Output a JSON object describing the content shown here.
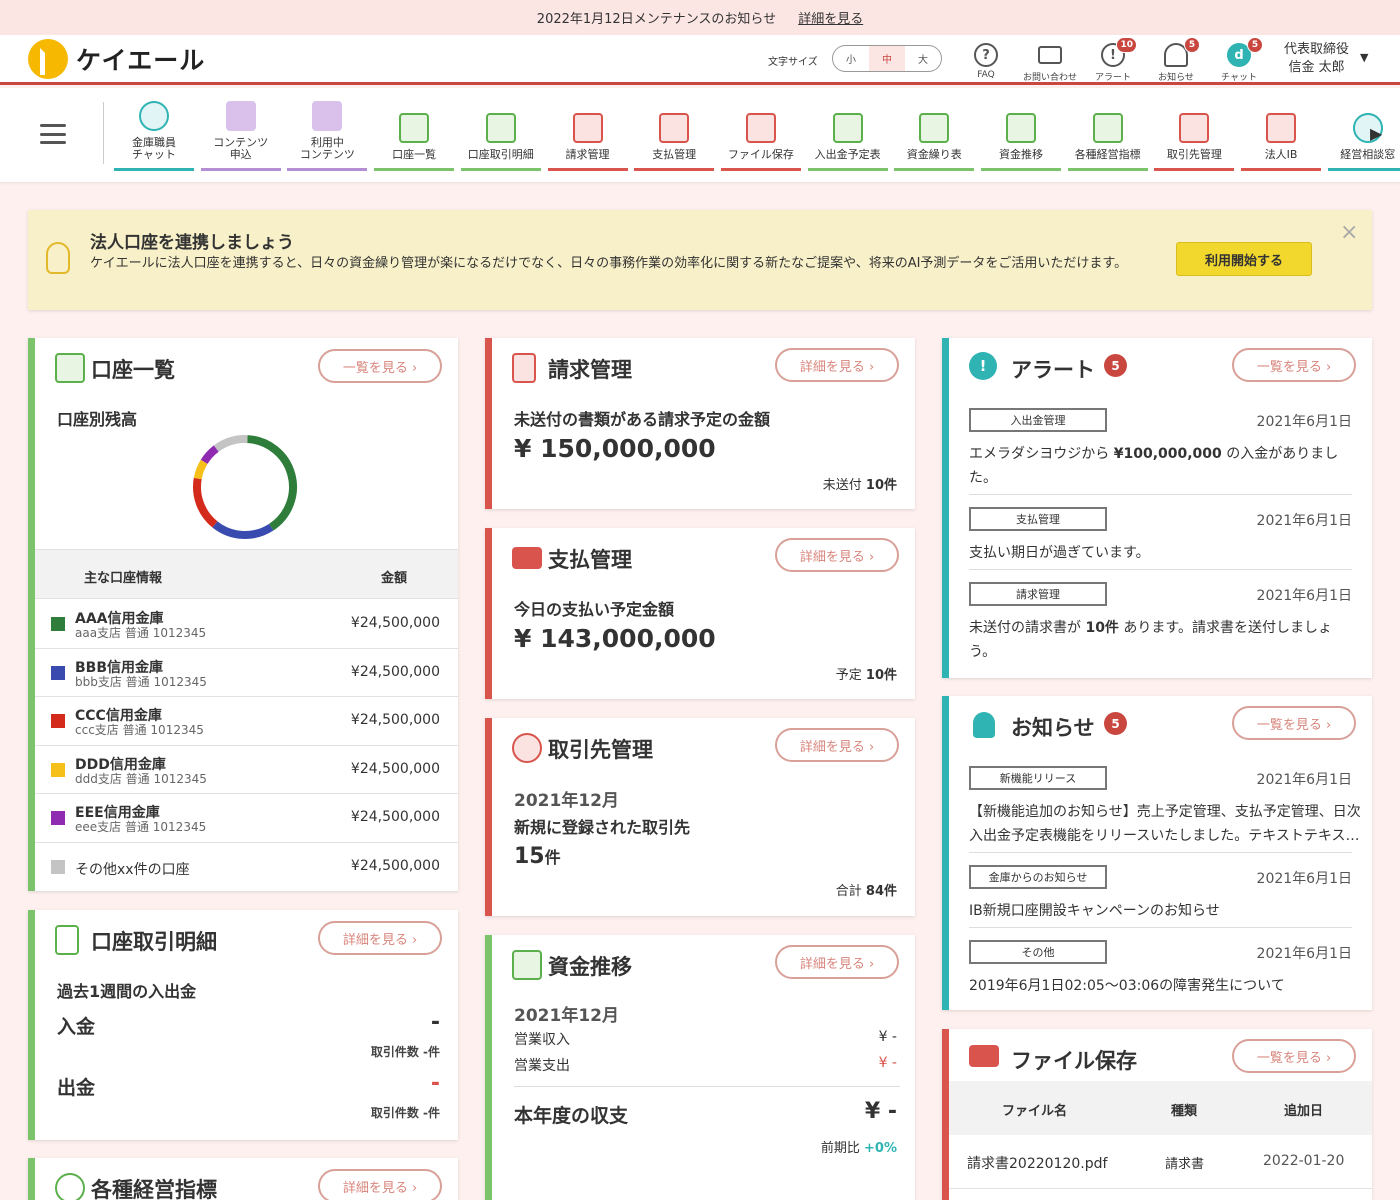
{
  "notice": {
    "text": "2022年1月12日メンテナンスのお知らせ",
    "link": "詳細を見る"
  },
  "header": {
    "logo": "ケイエール",
    "font_size_label": "文字サイズ",
    "font_sizes": [
      "小",
      "中",
      "大"
    ],
    "icons": [
      {
        "label": "FAQ",
        "glyph": "?",
        "icon": "question-icon",
        "badge": ""
      },
      {
        "label": "お問い合わせ",
        "glyph": "✉",
        "icon": "mail-icon",
        "badge": ""
      },
      {
        "label": "アラート",
        "glyph": "!",
        "icon": "alert-icon",
        "badge": "10"
      },
      {
        "label": "お知らせ",
        "glyph": "♪",
        "icon": "bell-icon",
        "badge": "5"
      },
      {
        "label": "チャット",
        "glyph": "d",
        "icon": "chat-icon",
        "badge": "5"
      }
    ],
    "user": {
      "title": "代表取締役",
      "name": "信金 太郎"
    }
  },
  "toolbar": [
    {
      "label": "金庫職員\nチャット",
      "style": "teal"
    },
    {
      "label": "コンテンツ\n申込",
      "style": "purple"
    },
    {
      "label": "利用中\nコンテンツ",
      "style": "purple"
    },
    {
      "label": "口座一覧",
      "style": "green"
    },
    {
      "label": "口座取引明細",
      "style": "green"
    },
    {
      "label": "請求管理",
      "style": "red"
    },
    {
      "label": "支払管理",
      "style": "red"
    },
    {
      "label": "ファイル保存",
      "style": "red"
    },
    {
      "label": "入出金予定表",
      "style": "green"
    },
    {
      "label": "資金繰り表",
      "style": "green"
    },
    {
      "label": "資金推移",
      "style": "green"
    },
    {
      "label": "各種経営指標",
      "style": "green"
    },
    {
      "label": "取引先管理",
      "style": "red"
    },
    {
      "label": "法人IB",
      "style": "red"
    },
    {
      "label": "経営相談窓",
      "style": "teal"
    }
  ],
  "banner": {
    "title": "法人口座を連携しましょう",
    "desc": "ケイエールに法人口座を連携すると、日々の資金繰り管理が楽になるだけでなく、日々の事務作業の効率化に関する新たなご提案や、将来のAI予測データをご活用いただけます。",
    "button": "利用開始する",
    "close": "×"
  },
  "accounts": {
    "title": "口座一覧",
    "link": "一覧を見る",
    "subtitle": "口座別残高",
    "col_info": "主な口座情報",
    "col_amount": "金額",
    "rows": [
      {
        "name": "AAA信用金庫",
        "sub": "aaa支店 普通 1012345",
        "amount": "¥24,500,000",
        "color": "#2e7d3a",
        "share": 0.4
      },
      {
        "name": "BBB信用金庫",
        "sub": "bbb支店 普通 1012345",
        "amount": "¥24,500,000",
        "color": "#3a4bb0",
        "share": 0.2
      },
      {
        "name": "CCC信用金庫",
        "sub": "ccc支店 普通 1012345",
        "amount": "¥24,500,000",
        "color": "#d42a1c",
        "share": 0.17
      },
      {
        "name": "DDD信用金庫",
        "sub": "ddd支店 普通 1012345",
        "amount": "¥24,500,000",
        "color": "#f5c01a",
        "share": 0.06
      },
      {
        "name": "EEE信用金庫",
        "sub": "eee支店 普通 1012345",
        "amount": "¥24,500,000",
        "color": "#8e2bb0",
        "share": 0.06
      },
      {
        "name": "その他xx件の口座",
        "sub": "",
        "amount": "¥24,500,000",
        "color": "#c4c4c4",
        "share": 0.11
      }
    ]
  },
  "statement": {
    "title": "口座取引明細",
    "link": "詳細を見る",
    "subtitle": "過去1週間の入出金",
    "in_label": "入金",
    "in_value": "-",
    "in_count": "取引件数 -件",
    "out_label": "出金",
    "out_value": "-",
    "out_count": "取引件数 -件"
  },
  "indicators": {
    "title": "各種経営指標",
    "link": "詳細を見る"
  },
  "billing": {
    "title": "請求管理",
    "link": "詳細を見る",
    "label": "未送付の書類がある請求予定の金額",
    "amount": "¥ 150,000,000",
    "foot_label": "未送付",
    "foot_value": "10件"
  },
  "payment": {
    "title": "支払管理",
    "link": "詳細を見る",
    "label": "今日の支払い予定金額",
    "amount": "¥ 143,000,000",
    "foot_label": "予定",
    "foot_value": "10件"
  },
  "partners": {
    "title": "取引先管理",
    "link": "詳細を見る",
    "month": "2021年12月",
    "label": "新規に登録された取引先",
    "count": "15",
    "count_unit": "件",
    "foot_label": "合計",
    "foot_value": "84件"
  },
  "funds": {
    "title": "資金推移",
    "link": "詳細を見る",
    "month": "2021年12月",
    "income_label": "営業収入",
    "income_value": "¥ -",
    "expense_label": "営業支出",
    "expense_value": "¥ -",
    "year_label": "本年度の収支",
    "year_value": "¥ -",
    "compare_label": "前期比",
    "compare_value": "+0%"
  },
  "alerts": {
    "title": "アラート",
    "count": "5",
    "link": "一覧を見る",
    "items": [
      {
        "tag": "入出金管理",
        "date": "2021年6月1日",
        "pre": "エメラダシヨウジから ",
        "strong": "¥100,000,000",
        "post": " の入金がありまし",
        "line2": "た。"
      },
      {
        "tag": "支払管理",
        "date": "2021年6月1日",
        "pre": "支払い期日が過ぎています。",
        "strong": "",
        "post": "",
        "line2": ""
      },
      {
        "tag": "請求管理",
        "date": "2021年6月1日",
        "pre": "未送付の請求書が ",
        "strong": "10件",
        "post": " あります。請求書を送付しましょ",
        "line2": "う。"
      }
    ]
  },
  "news": {
    "title": "お知らせ",
    "count": "5",
    "link": "一覧を見る",
    "items": [
      {
        "tag": "新機能リリース",
        "date": "2021年6月1日",
        "line1": "【新機能追加のお知らせ】売上予定管理、支払予定管理、日次",
        "line2": "入出金予定表機能をリリースいたしました。テキストテキス…"
      },
      {
        "tag": "金庫からのお知らせ",
        "date": "2021年6月1日",
        "line1": "IB新規口座開設キャンペーンのお知らせ",
        "line2": ""
      },
      {
        "tag": "その他",
        "date": "2021年6月1日",
        "line1": "2019年6月1日02:05〜03:06の障害発生について",
        "line2": ""
      }
    ]
  },
  "files": {
    "title": "ファイル保存",
    "link": "一覧を見る",
    "col_name": "ファイル名",
    "col_type": "種類",
    "col_date": "追加日",
    "rows": [
      {
        "name": "請求書20220120.pdf",
        "type": "請求書",
        "date": "2022-01-20"
      }
    ]
  }
}
